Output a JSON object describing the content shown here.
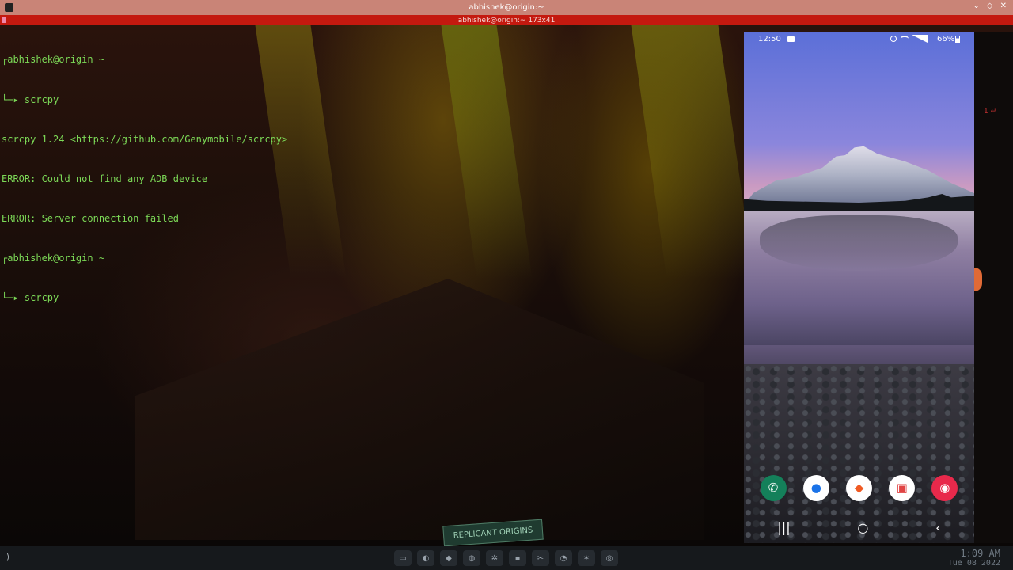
{
  "window": {
    "title": "abhishek@origin:~",
    "tab_title": "abhishek@origin:~ 173x41",
    "controls": [
      "⌄",
      "◇",
      "✕"
    ]
  },
  "terminal": {
    "lines": [
      {
        "prompt": "┌",
        "text": "abhishek@origin ~"
      },
      {
        "prompt": "└─▸",
        "text": " scrcpy"
      },
      {
        "prompt": "",
        "text": "scrcpy 1.24 <https://github.com/Genymobile/scrcpy>"
      },
      {
        "prompt": "",
        "text": "ERROR: Could not find any ADB device"
      },
      {
        "prompt": "",
        "text": "ERROR: Server connection failed"
      },
      {
        "prompt": "┌",
        "text": "abhishek@origin ~"
      },
      {
        "prompt": "└─▸",
        "text": " scrcpy"
      }
    ]
  },
  "wallpaper": {
    "sign_text": "REPLICANT ORIGINS"
  },
  "phone": {
    "time": "12:50",
    "battery": "66%",
    "icons": [
      "screen-record-icon",
      "alarm-icon",
      "wifi-icon",
      "signal-icon",
      "battery-icon"
    ],
    "dock_apps": [
      {
        "name": "phone-app-icon",
        "glyph": "✆"
      },
      {
        "name": "messages-app-icon",
        "glyph": "●"
      },
      {
        "name": "brave-app-icon",
        "glyph": "◆"
      },
      {
        "name": "gallery-app-icon",
        "glyph": "▣"
      },
      {
        "name": "camera-app-icon",
        "glyph": "◉"
      }
    ],
    "nav": {
      "recents": "|||",
      "home": "○",
      "back": "‹"
    }
  },
  "taskbar": {
    "launcher": "⟩",
    "apps": [
      "▭",
      "◐",
      "◆",
      "◍",
      "✲",
      "▪",
      "✂",
      "◔",
      "✶",
      "◎"
    ],
    "clock_time": "1:09 AM",
    "clock_date": "Tue 08 2022"
  },
  "colors": {
    "titlebar": "#c98477",
    "tabbar": "#c4190f",
    "terminal_text": "#7cd957",
    "taskbar": "#16191c"
  }
}
